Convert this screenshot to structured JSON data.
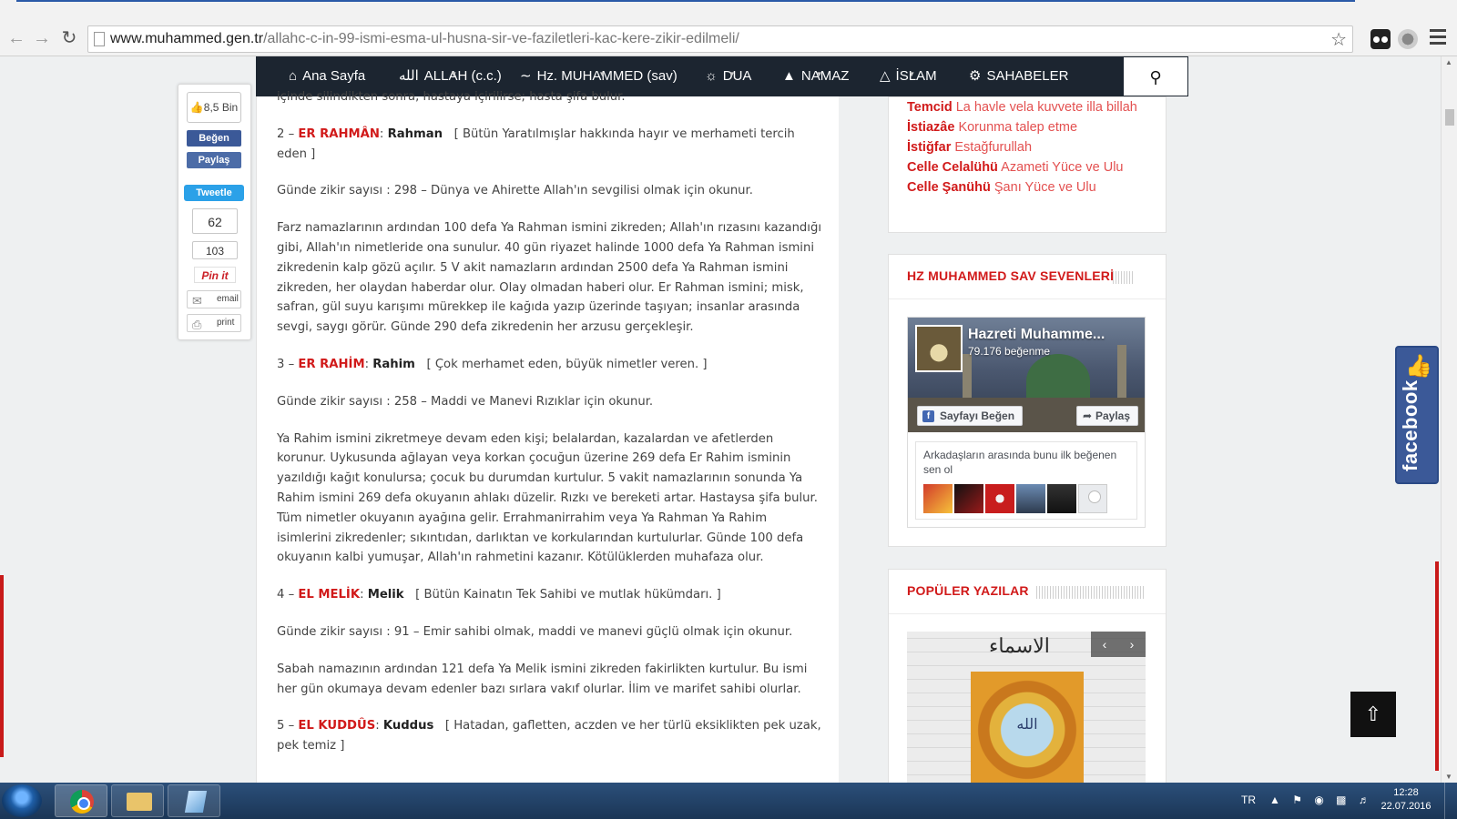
{
  "browser": {
    "url_host": "www.muhammed.gen.tr",
    "url_path": "/allahc-c-in-99-ismi-esma-ul-husna-sir-ve-faziletleri-kac-kere-zikir-edilmeli/"
  },
  "nav": {
    "items": [
      {
        "label": "Ana Sayfa",
        "icon": "home-icon"
      },
      {
        "label": "ALLAH (c.c.)",
        "icon": "allah-icon"
      },
      {
        "label": "Hz. MUHAMMED (sav)",
        "icon": "mustache-icon"
      },
      {
        "label": "DUA",
        "icon": "dua-icon"
      },
      {
        "label": "NAMAZ",
        "icon": "mosque-icon"
      },
      {
        "label": "İSLAM",
        "icon": "mosque-dome-icon"
      },
      {
        "label": "SAHABELER",
        "icon": "gear-icon"
      }
    ]
  },
  "share": {
    "like_count": "8,5 Bin",
    "fb_like": "Beğen",
    "fb_share": "Paylaş",
    "tweet": "Tweetle",
    "count_1": "62",
    "count_2": "103",
    "pinit": "Pin it",
    "email": "email",
    "print": "print"
  },
  "article": {
    "top_line": "içinde silindikten sonra, hastaya içirilirse; hasta şifa bulur.",
    "sections": [
      {
        "num": "2 –",
        "arabic": "ER RAHMÂN",
        "name": "Rahman",
        "desc": "[ Bütün Yaratılmışlar hakkında hayır ve merhameti tercih eden ]",
        "zikir": "Günde zikir sayısı : 298  – Dünya ve Ahirette Allah'ın sevgilisi olmak için okunur.",
        "body": "Farz namazlarının ardından 100 defa Ya Rahman ismini zikreden; Allah'ın rızasını kazandığı gibi, Allah'ın nimetleride ona sunulur. 40 gün riyazet halinde 1000 defa Ya Rahman ismini zikredenin kalp gözü açılır. 5 V akit namazların ardından 2500 defa Ya Rahman ismini zikreden, her olaydan haberdar olur. Olay olmadan haberi olur. Er Rahman ismini; misk, safran, gül suyu karışımı mürekkep ile kağıda yazıp üzerinde taşıyan; insanlar arasında sevgi, saygı görür. Günde 290 defa zikredenin her arzusu gerçekleşir."
      },
      {
        "num": "3 –",
        "arabic": "ER RAHİM",
        "name": "Rahim",
        "desc": "[ Çok merhamet eden, büyük nimetler veren. ]",
        "zikir": "Günde zikir sayısı : 258 – Maddi ve Manevi Rızıklar için okunur.",
        "body": "Ya Rahim ismini zikretmeye devam eden kişi; belalardan, kazalardan ve afetlerden korunur. Uykusunda ağlayan veya korkan çocuğun üzerine 269 defa Er Rahim isminin yazıldığı kağıt konulursa; çocuk bu durumdan kurtulur. 5 vakit namazlarının sonunda Ya Rahim ismini 269 defa okuyanın ahlakı düzelir. Rızkı ve bereketi artar. Hastaysa şifa bulur. Tüm nimetler okuyanın ayağına gelir. Errahmanirrahim veya Ya Rahman Ya Rahim isimlerini zikredenler; sıkıntıdan, darlıktan ve korkularından kurtulurlar. Günde 100 defa okuyanın kalbi yumuşar, Allah'ın rahmetini kazanır. Kötülüklerden muhafaza olur."
      },
      {
        "num": "4 –",
        "arabic": "EL MELİK",
        "name": "Melik",
        "desc": "[ Bütün Kainatın Tek Sahibi ve mutlak hükümdarı. ]",
        "zikir": "Günde zikir sayısı : 91 – Emir sahibi olmak, maddi ve manevi güçlü olmak için okunur.",
        "body": "Sabah namazının ardından 121 defa Ya Melik ismini zikreden fakirlikten kurtulur. Bu ismi her gün okumaya devam edenler bazı sırlara vakıf olurlar. İlim ve marifet sahibi olurlar."
      },
      {
        "num": "5 –",
        "arabic": "EL KUDDÛS",
        "name": "Kuddus",
        "desc": "[ Hatadan, gafletten, aczden ve her türlü eksiklikten pek uzak, pek temiz ]"
      }
    ]
  },
  "sidebar": {
    "duas": [
      {
        "term": "Temcid",
        "meaning": "La havle vela kuvvete illa billah"
      },
      {
        "term": "İstiazâe",
        "meaning": "Korunma talep etme"
      },
      {
        "term": "İstiğfar",
        "meaning": "Estağfurullah"
      },
      {
        "term": "Celle Celalühü",
        "meaning": "Azameti Yüce ve Ulu"
      },
      {
        "term": "Celle Şanühü",
        "meaning": "Şanı Yüce ve Ulu"
      }
    ],
    "fb_widget_title": "HZ MUHAMMED SAV SEVENLERİ",
    "fb_page_name": "Hazreti Muhamme...",
    "fb_page_likes": "79.176 beğenme",
    "fb_like_page": "Sayfayı Beğen",
    "fb_share_page": "Paylaş",
    "fb_friends_text": "Arkadaşların arasında bunu ilk beğenen sen ol",
    "popular_title": "POPÜLER YAZILAR"
  },
  "fb_side_tab": "facebook",
  "taskbar": {
    "lang": "TR",
    "time": "12:28",
    "date": "22.07.2016"
  },
  "colors": {
    "accent_red": "#d11a1a",
    "nav_dark": "#1c2530",
    "facebook_blue": "#3b5998",
    "twitter_blue": "#2ba1e8"
  }
}
